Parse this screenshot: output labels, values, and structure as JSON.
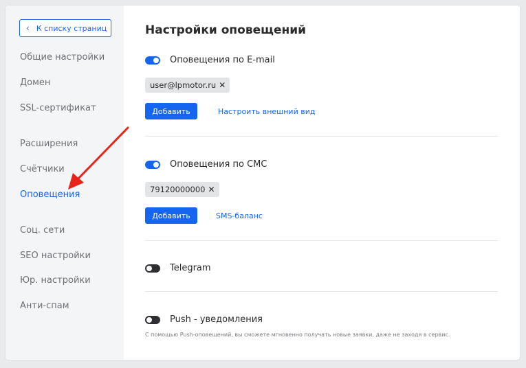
{
  "sidebar": {
    "back_label": "К списку страниц",
    "items": [
      {
        "label": "Общие настройки"
      },
      {
        "label": "Домен"
      },
      {
        "label": "SSL-сертификат"
      },
      {
        "label": "Расширения"
      },
      {
        "label": "Счётчики"
      },
      {
        "label": "Оповещения"
      },
      {
        "label": "Соц. сети"
      },
      {
        "label": "SEO настройки"
      },
      {
        "label": "Юр. настройки"
      },
      {
        "label": "Анти-спам"
      }
    ],
    "active_item": "Оповещения"
  },
  "main": {
    "title": "Настройки оповещений",
    "email": {
      "label": "Оповещения по E-mail",
      "enabled": true,
      "tag": "user@lpmotor.ru",
      "add_label": "Добавить",
      "link_label": "Настроить внешний вид"
    },
    "sms": {
      "label": "Оповещения по СМС",
      "enabled": true,
      "tag": "79120000000",
      "add_label": "Добавить",
      "link_label": "SMS-баланс"
    },
    "telegram": {
      "label": "Telegram",
      "enabled": false
    },
    "push": {
      "label": "Push - уведомления",
      "enabled": false,
      "hint": "С помощью Push-оповещений, вы сможете мгновенно получать новые заявки, даже не заходя в сервис."
    }
  },
  "colors": {
    "accent": "#1565f0",
    "annotation_arrow": "#e8231a"
  }
}
